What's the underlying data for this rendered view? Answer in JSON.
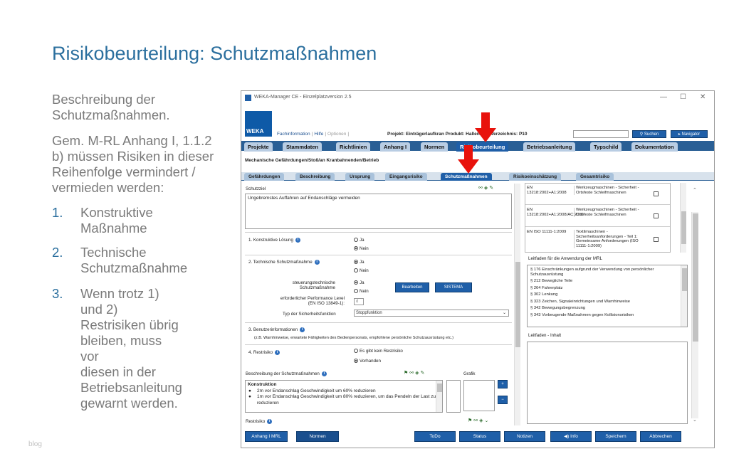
{
  "slide": {
    "title": "Risikobeurteilung: Schutzmaßnahmen",
    "intro1_line1": "Beschreibung der",
    "intro1_line2": "Schutzmaßnahmen.",
    "intro2_line1": "Gem. M-RL Anhang I, 1.1.2",
    "intro2_line2": "b) müssen Risiken in dieser",
    "intro2_line3": "Reihenfolge vermindert /",
    "intro2_line4": "vermieden werden:",
    "list": [
      {
        "num": "1.",
        "lines": [
          "Konstruktive",
          "Maßnahme"
        ]
      },
      {
        "num": "2.",
        "lines": [
          "Technische",
          "Schutzmaßnahme"
        ]
      },
      {
        "num": "3.",
        "lines": [
          "Wenn trotz 1) und 2)",
          "Restrisiken übrig",
          "bleiben, muss vor",
          "diesen in der",
          "Betriebsanleitung",
          "gewarnt werden."
        ]
      }
    ],
    "watermark": "blog"
  },
  "app": {
    "window_title": "WEKA-Manager CE - Einzelplatzversion 2.5",
    "logo_text": "WEKA",
    "links": {
      "fachinfo": "Fachinformation",
      "hilfe": "Hilfe",
      "optionen": "Optionen"
    },
    "project_line": "Projekt: Einträgerlaufkran   Produkt: Hallenkran   Verzeichnis: P10",
    "search_label": "Suchen",
    "navigator_label": "Navigator",
    "main_tabs": [
      "Projekte",
      "Stammdaten",
      "Richtlinien",
      "Anhang I",
      "Normen",
      "Risikobeurteilung",
      "Betriebsanleitung",
      "Typschild",
      "Dokumentation"
    ],
    "breadcrumb": "Mechanische Gefährdungen/Stoß/an Kranbahnenden/Betrieb",
    "sub_tabs": [
      "Gefährdungen",
      "Beschreibung",
      "Ursprung",
      "Eingangsrisiko",
      "Schutzmaßnahmen",
      "Risikoeinschätzung",
      "Gesamtrisiko"
    ],
    "schutzziel_label": "Schutzziel",
    "schutzziel_text": "Ungebremstes Auffahren auf Endanschläge vermeiden",
    "q1_label": "1. Konstruktive Lösung",
    "q2_label": "2. Technische Schutzmaßnahme",
    "q3_label": "3. Benutzerinformationen",
    "q3_hint": "(z.B. Warnhinweise, erwartete Fähigkeiten des Bedienpersonals, empfohlene persönliche Schutzausrüstung etc.)",
    "q4_label": "4. Restrisiko",
    "ja": "Ja",
    "nein": "Nein",
    "steuerung_line1": "steuerungstechnische",
    "steuerung_line2": "Schutzmaßnahme",
    "pl_line1": "erforderlicher Performance Level",
    "pl_line2": "(EN ISO 13849-1):",
    "pl_value": "d",
    "bearbeiten": "Bearbeiten",
    "sistema": "SISTEMA",
    "typ_label": "Typ der Sicherheitsfunktion",
    "typ_value": "Stoppfunktion",
    "restrisiko_opt1": "Es gibt kein Restrisiko",
    "restrisiko_opt2": "Vorhanden",
    "beschreibung_label": "Beschreibung der Schutzmaßnahmen",
    "grafik_label": "Grafik",
    "desc_title": "Konstruktion",
    "desc_bullets": [
      "2m vor Endanschlag Geschwindigkeit um 60% reduzieren",
      "1m vor Endanschlag Geschwindigkeit um 80% reduzieren, um das Pendeln der Last zu reduzieren"
    ],
    "restrisiko_label": "Restrisiko",
    "norms": [
      {
        "code": "EN 13218:2002+A1:2008",
        "title": "Werkzeugmaschinen - Sicherheit - Ortsfeste Schleifmaschinen"
      },
      {
        "code": "EN 13218:2002+A1:2008/AC:2010",
        "title": "Werkzeugmaschinen - Sicherheit - Ortsfeste Schleifmaschinen"
      },
      {
        "code": "EN ISO 11111-1:2009",
        "title": "Textilmaschinen - Sicherheitsanforderungen - Teil 1: Gemeinsame Anforderungen (ISO 11111-1:2009)"
      }
    ],
    "leitfaden_title": "Leitfaden für die Anwendung der MRL",
    "leitfaden_items": [
      "§ 176 Einschränkungen aufgrund der Verwendung von persönlicher Schutzausrüstung",
      "§ 212 Bewegliche Teile",
      "§ 264 Fahrerplatz",
      "§ 302 Lenkung",
      "§ 323 Zeichen, Signaleinrichtungen und Warnhinweise",
      "§ 342 Bewegungsbegrenzung",
      "§ 343 Vorbeugende Maßnahmen gegen Kollisionsrisiken"
    ],
    "leitfaden_inhalt_title": "Leitfaden - Inhalt",
    "bottom_buttons": [
      "Anhang I MRL",
      "Normen",
      "ToDo",
      "Status",
      "Notizen",
      "Info",
      "Speichern",
      "Abbrechen"
    ],
    "colors": {
      "accent": "#1f5fa8",
      "tabbar": "#2a5f95",
      "arrow": "#e8120c"
    }
  }
}
